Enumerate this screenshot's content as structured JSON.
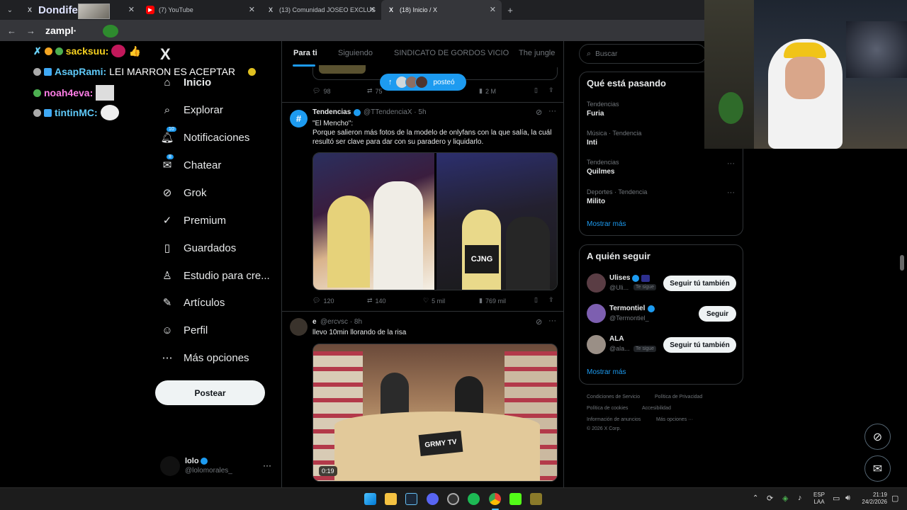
{
  "browser": {
    "tabs": [
      {
        "label": "Dondife:",
        "favicon": "X"
      },
      {
        "label": "(7) YouTube",
        "favicon": "▶"
      },
      {
        "label": "(13) Comunidad JOSEO EXCLUS",
        "favicon": "X"
      },
      {
        "label": "(18) Inicio / X",
        "favicon": "X"
      }
    ],
    "new_tab": "+",
    "address_overlay_text": "zampl·"
  },
  "chat": [
    {
      "user": "sacksuu:",
      "message": "",
      "color": "#f5d020"
    },
    {
      "user": "AsapRami:",
      "message": "LEI MARRON ES ACEPTAR",
      "color": "#5fc9f8"
    },
    {
      "user": "noah4eva:",
      "message": "",
      "color": "#ff7ee7"
    },
    {
      "user": "tintinMC:",
      "message": "",
      "color": "#5fc9f8"
    }
  ],
  "nav": {
    "logo": "X",
    "items": [
      {
        "label": "Inicio",
        "icon": "home-icon"
      },
      {
        "label": "Explorar",
        "icon": "search-icon"
      },
      {
        "label": "Notificaciones",
        "icon": "bell-icon",
        "badge": "10"
      },
      {
        "label": "Chatear",
        "icon": "mail-icon",
        "badge": "8"
      },
      {
        "label": "Grok",
        "icon": "grok-icon"
      },
      {
        "label": "Premium",
        "icon": "premium-icon"
      },
      {
        "label": "Guardados",
        "icon": "bookmark-icon"
      },
      {
        "label": "Estudio para cre...",
        "icon": "studio-icon"
      },
      {
        "label": "Artículos",
        "icon": "articles-icon"
      },
      {
        "label": "Perfil",
        "icon": "person-icon"
      },
      {
        "label": "Más opciones",
        "icon": "more-icon"
      }
    ],
    "post_button": "Postear",
    "account": {
      "name": "lolo",
      "handle": "@lolomorales_"
    }
  },
  "feed": {
    "tabs": [
      "Para ti",
      "Siguiendo",
      "SINDICATO DE GORDOS VICIO",
      "The jungle"
    ],
    "posted_pill": "posteó",
    "prev_tweet_metrics": {
      "replies": "98",
      "retweets": "75",
      "views": "2 M"
    },
    "tweet1": {
      "name": "Tendencias",
      "handle": "@TTendenciaX · 5h",
      "line1": "\"El Mencho\":",
      "line2": "Porque salieron más fotos de la modelo de onlyfans con la que salía, la cuál resultó ser clave para dar con su paradero y liquidarlo.",
      "vest_text": "CJNG",
      "metrics": {
        "replies": "120",
        "retweets": "140",
        "likes": "5 mil",
        "views": "769 mil"
      }
    },
    "tweet2": {
      "name": "e",
      "handle": "@ercvsc · 8h",
      "text": "llevo 10min llorando de la risa",
      "video_time": "0:19",
      "table_text": "GRMY TV"
    }
  },
  "right": {
    "search_placeholder": "Buscar",
    "trends_title": "Qué está pasando",
    "trends": [
      {
        "meta": "Tendencias",
        "name": "Furia"
      },
      {
        "meta": "Música · Tendencia",
        "name": "Inti"
      },
      {
        "meta": "Tendencias",
        "name": "Quilmes"
      },
      {
        "meta": "Deportes · Tendencia",
        "name": "Milito"
      }
    ],
    "show_more": "Mostrar más",
    "follow_title": "A quién seguir",
    "follow": [
      {
        "name": "Ulises",
        "handle": "@Uli...",
        "tag": "Te sigue",
        "button": "Seguir tú también"
      },
      {
        "name": "Termontiel",
        "handle": "@Termontiel_",
        "tag": "",
        "button": "Seguir"
      },
      {
        "name": "ALA",
        "handle": "@ala...",
        "tag": "Te sigue",
        "button": "Seguir tú también"
      }
    ],
    "legal": {
      "line1a": "Condiciones de Servicio",
      "line1b": "Política de Privacidad",
      "line2a": "Política de cookies",
      "line2b": "Accesibilidad",
      "line3a": "Información de anuncios",
      "line3b": "Más opciones ···",
      "line4": "© 2026 X Corp."
    }
  },
  "taskbar": {
    "lang1": "ESP",
    "lang2": "LAA",
    "time": "21:19",
    "date": "24/2/2026"
  },
  "colors": {
    "accent": "#1d9bf0",
    "background": "#000000",
    "border": "#2f3336",
    "muted": "#71767b"
  }
}
